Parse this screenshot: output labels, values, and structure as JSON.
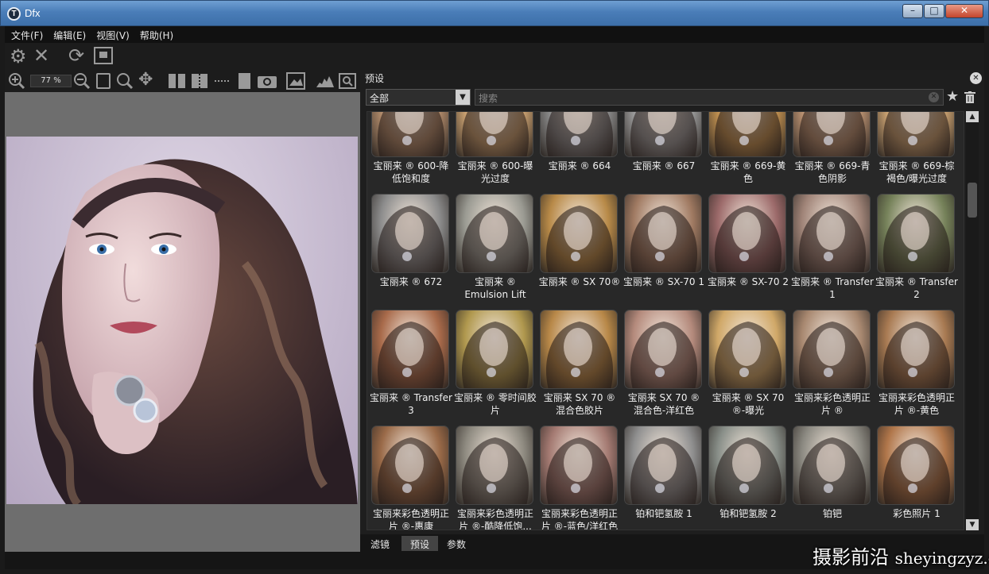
{
  "window": {
    "title": "Dfx"
  },
  "menu": [
    "文件(F)",
    "编辑(E)",
    "视图(V)",
    "帮助(H)"
  ],
  "toolbar2": {
    "zoom": "77 %"
  },
  "preset_panel": {
    "title": "预设",
    "filter_selected": "全部",
    "search_placeholder": "搜索",
    "presets": [
      {
        "label": "宝丽来 ® 600-降低饱和度",
        "tone": "#b08a6a"
      },
      {
        "label": "宝丽来 ® 600-曝光过度",
        "tone": "#c9a070"
      },
      {
        "label": "宝丽来 ® 664",
        "tone": "#8a8a8a"
      },
      {
        "label": "宝丽来 ® 667",
        "tone": "#9a9a9a"
      },
      {
        "label": "宝丽来 ® 669-黄色",
        "tone": "#c09050"
      },
      {
        "label": "宝丽来 ® 669-青色阴影",
        "tone": "#b89070"
      },
      {
        "label": "宝丽来 ® 669-棕褐色/曝光过度",
        "tone": "#c8a070"
      },
      {
        "label": "宝丽来 ® 672",
        "tone": "#8c8c8c"
      },
      {
        "label": "宝丽来 ® Emulsion Lift",
        "tone": "#9a9a92"
      },
      {
        "label": "宝丽来 ® SX 70®",
        "tone": "#b88a48"
      },
      {
        "label": "宝丽来 ® SX-70 1",
        "tone": "#a07a62"
      },
      {
        "label": "宝丽来 ® SX-70 2",
        "tone": "#9c6a6a"
      },
      {
        "label": "宝丽来 ® Transfer 1",
        "tone": "#a08478"
      },
      {
        "label": "宝丽来 ® Transfer 2",
        "tone": "#76825a"
      },
      {
        "label": "宝丽来 ® Transfer 3",
        "tone": "#a86a4a"
      },
      {
        "label": "宝丽来 ® 零时间胶片",
        "tone": "#b0984e"
      },
      {
        "label": "宝丽来 SX 70 ® 混合色胶片",
        "tone": "#b88848"
      },
      {
        "label": "宝丽来 SX 70 ® 混合色-洋红色",
        "tone": "#b48a7c"
      },
      {
        "label": "宝丽来 ® SX 70 ®-曝光",
        "tone": "#d0a868"
      },
      {
        "label": "宝丽来彩色透明正片 ®",
        "tone": "#a88870"
      },
      {
        "label": "宝丽来彩色透明正片 ®-黄色",
        "tone": "#a87a52"
      },
      {
        "label": "宝丽来彩色透明正片 ®-惠康",
        "tone": "#9a6a48"
      },
      {
        "label": "宝丽来彩色透明正片 ®-酷降低饱...",
        "tone": "#8e8a80"
      },
      {
        "label": "宝丽来彩色透明正片 ®-蓝色/洋红色",
        "tone": "#a47a72"
      },
      {
        "label": "铂和钯氢胺 1",
        "tone": "#909090"
      },
      {
        "label": "铂和钯氢胺 2",
        "tone": "#888e88"
      },
      {
        "label": "铂钯",
        "tone": "#8c8a82"
      },
      {
        "label": "彩色照片 1",
        "tone": "#b0764a"
      }
    ]
  },
  "tabs": [
    "滤镜",
    "预设",
    "参数"
  ],
  "watermark": {
    "cn": "摄影前沿",
    "en": "sheyingzyz.com"
  }
}
